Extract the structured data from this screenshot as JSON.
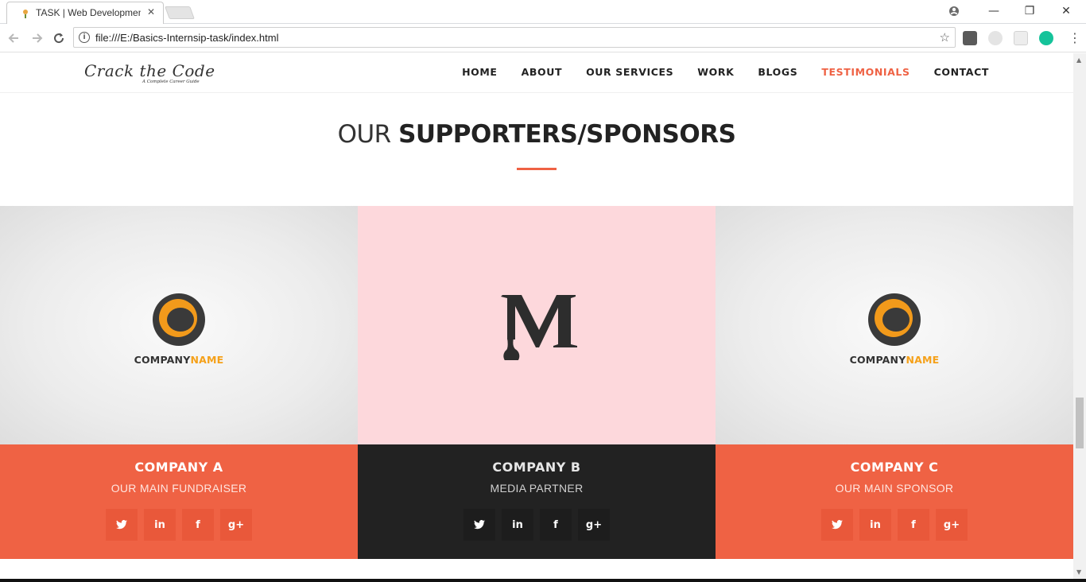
{
  "browser": {
    "tab_title": "TASK | Web Developmen",
    "url": "file:///E:/Basics-Internsip-task/index.html",
    "win_minimize": "—",
    "win_restore": "❐",
    "win_close": "✕",
    "profile_icon": "profile-icon",
    "extensions": [
      "metamask-extension-icon",
      "leaf-extension-icon",
      "puzzle-extension-icon",
      "grammarly-extension-icon"
    ]
  },
  "site": {
    "logo_main": "Crack the Code",
    "logo_sub": "A Complete Career Guide",
    "nav": [
      {
        "label": "HOME",
        "active": false
      },
      {
        "label": "ABOUT",
        "active": false
      },
      {
        "label": "OUR SERVICES",
        "active": false
      },
      {
        "label": "WORK",
        "active": false
      },
      {
        "label": "BLOGS",
        "active": false
      },
      {
        "label": "TESTIMONIALS",
        "active": true
      },
      {
        "label": "CONTACT",
        "active": false
      }
    ],
    "accent_color": "#ef6244"
  },
  "section": {
    "title_light": "OUR ",
    "title_bold": "SUPPORTERS/SPONSORS"
  },
  "sponsors": [
    {
      "name": "COMPANY A",
      "role": "OUR MAIN FUNDRAISER",
      "logo_word_1": "COMPANY",
      "logo_word_2": "NAME",
      "theme": "orange"
    },
    {
      "name": "COMPANY B",
      "role": "MEDIA PARTNER",
      "logo_letter": "M",
      "theme": "dark"
    },
    {
      "name": "COMPANY C",
      "role": "OUR MAIN SPONSOR",
      "logo_word_1": "COMPANY",
      "logo_word_2": "NAME",
      "theme": "orange"
    }
  ],
  "social_icons": {
    "twitter": "t",
    "linkedin": "in",
    "facebook": "f",
    "googleplus": "g+"
  }
}
